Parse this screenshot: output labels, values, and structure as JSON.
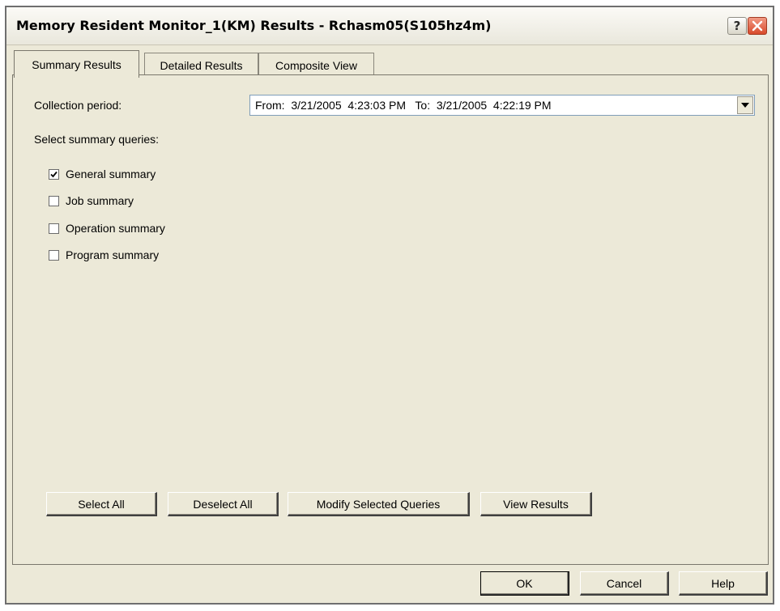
{
  "window": {
    "title": "Memory Resident Monitor_1(KM) Results - Rchasm05(S105hz4m)",
    "help_symbol": "?",
    "close_icon": "close-icon"
  },
  "tabs": [
    {
      "label": "Summary Results",
      "active": true
    },
    {
      "label": "Detailed Results",
      "active": false
    },
    {
      "label": "Composite View",
      "active": false
    }
  ],
  "summary": {
    "collection_label": "Collection period:",
    "collection_value": "From:  3/21/2005  4:23:03 PM   To:  3/21/2005  4:22:19 PM",
    "queries_label": "Select summary queries:",
    "queries": [
      {
        "label": "General summary",
        "checked": true
      },
      {
        "label": "Job summary",
        "checked": false
      },
      {
        "label": "Operation summary",
        "checked": false
      },
      {
        "label": "Program summary",
        "checked": false
      }
    ],
    "buttons": {
      "select_all": "Select All",
      "deselect_all": "Deselect All",
      "modify": "Modify Selected Queries",
      "view_results": "View Results"
    }
  },
  "footer": {
    "ok": "OK",
    "cancel": "Cancel",
    "help": "Help"
  },
  "colors": {
    "dialog_face": "#ece9d8",
    "close_button": "#d84a2c"
  }
}
